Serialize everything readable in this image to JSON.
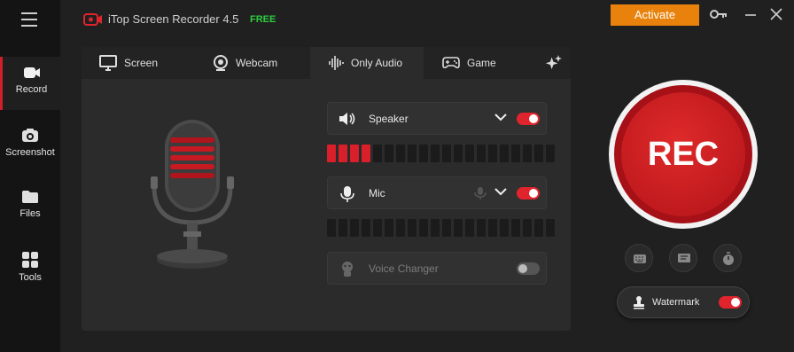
{
  "app": {
    "title": "iTop Screen Recorder 4.5",
    "edition": "FREE",
    "activate_label": "Activate"
  },
  "sidebar": {
    "items": [
      {
        "label": "Record",
        "icon": "camera-icon",
        "active": true
      },
      {
        "label": "Screenshot",
        "icon": "screenshot-icon",
        "active": false
      },
      {
        "label": "Files",
        "icon": "folder-icon",
        "active": false
      },
      {
        "label": "Tools",
        "icon": "tools-grid-icon",
        "active": false
      }
    ]
  },
  "tabs": [
    {
      "label": "Screen",
      "icon": "monitor-icon",
      "active": false
    },
    {
      "label": "Webcam",
      "icon": "webcam-icon",
      "active": false
    },
    {
      "label": "Only Audio",
      "icon": "audio-wave-icon",
      "active": true
    },
    {
      "label": "Game",
      "icon": "gamepad-icon",
      "active": false
    }
  ],
  "audio": {
    "speaker": {
      "label": "Speaker",
      "enabled": true,
      "level_segments_lit": 4,
      "total_segments": 20
    },
    "mic": {
      "label": "Mic",
      "enabled": true,
      "level_segments_lit": 0,
      "total_segments": 20
    },
    "voice_changer": {
      "label": "Voice Changer",
      "enabled": false
    }
  },
  "record": {
    "rec_label": "REC",
    "watermark_label": "Watermark",
    "watermark_enabled": true
  },
  "colors": {
    "accent_red": "#d81f2a",
    "activate_orange": "#e8820c",
    "free_green": "#2ecc40"
  }
}
